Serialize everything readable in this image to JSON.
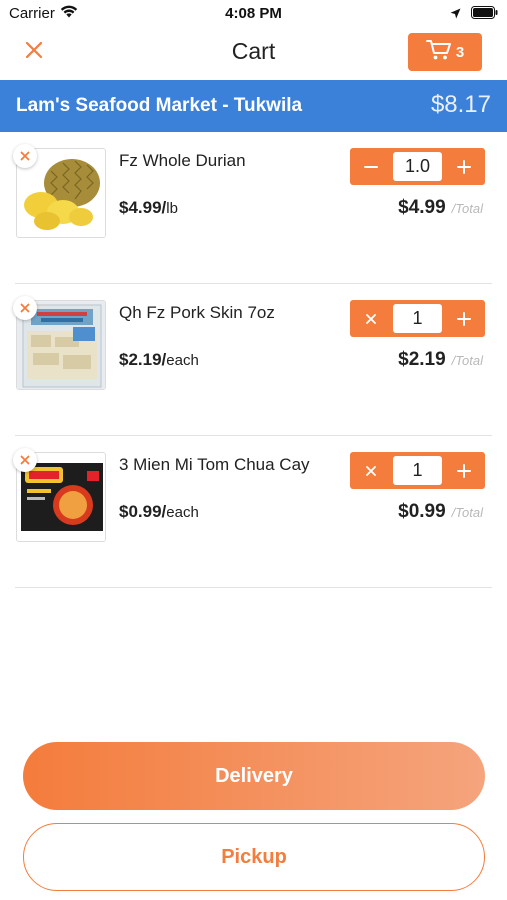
{
  "status_bar": {
    "carrier": "Carrier",
    "time": "4:08 PM"
  },
  "header": {
    "title": "Cart",
    "cart_count": "3"
  },
  "store": {
    "name": "Lam's Seafood Market - Tukwila",
    "total": "$8.17"
  },
  "items": [
    {
      "name": "Fz Whole Durian",
      "price": "$4.99/",
      "unit": "lb",
      "quantity": "1.0",
      "decrement_icon": "minus-icon",
      "line_total": "$4.99",
      "total_label": "/Total"
    },
    {
      "name": "Qh Fz Pork Skin 7oz",
      "price": "$2.19/",
      "unit": "each",
      "quantity": "1",
      "decrement_icon": "remove-icon",
      "line_total": "$2.19",
      "total_label": "/Total"
    },
    {
      "name": "3 Mien Mi Tom Chua Cay",
      "price": "$0.99/",
      "unit": "each",
      "quantity": "1",
      "decrement_icon": "remove-icon",
      "line_total": "$0.99",
      "total_label": "/Total"
    }
  ],
  "actions": {
    "delivery_label": "Delivery",
    "pickup_label": "Pickup"
  },
  "colors": {
    "accent": "#f47c3c",
    "store_bar": "#3b80d9"
  }
}
